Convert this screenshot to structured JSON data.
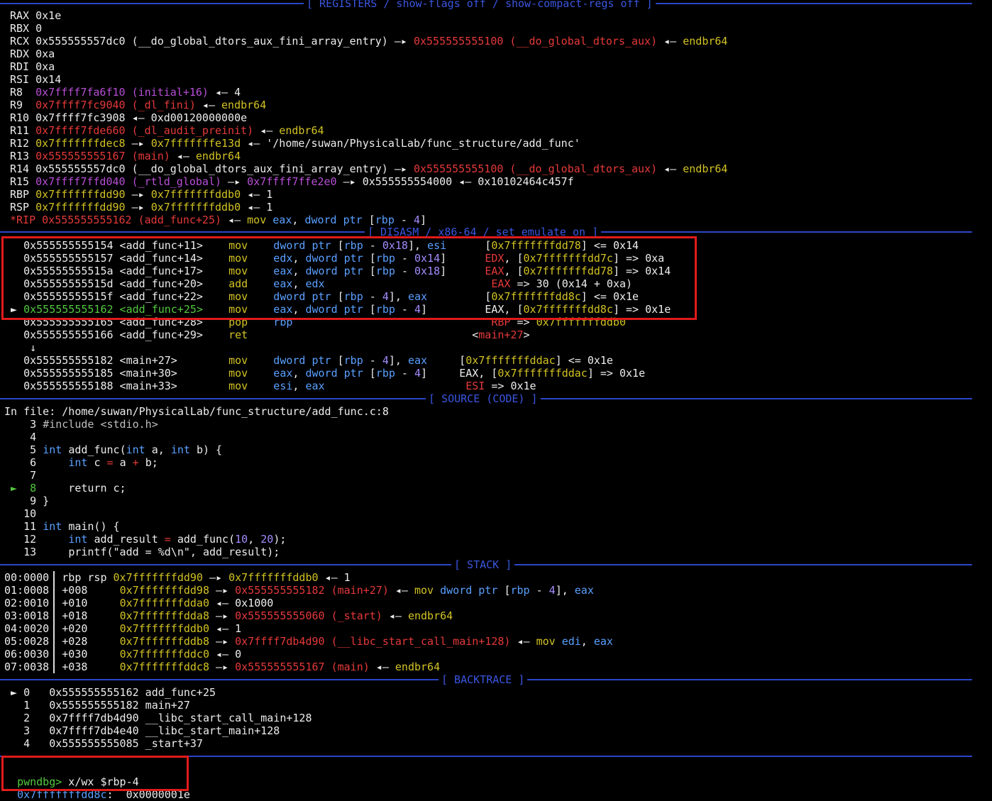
{
  "sections": {
    "registers": "[ REGISTERS / show-flags off / show-compact-regs off ]",
    "disasm": "[ DISASM / x86-64 / set emulate on ]",
    "source": "[ SOURCE (CODE) ]",
    "stack": "[ STACK ]",
    "backtrace": "[ BACKTRACE ]"
  },
  "registers": [
    [
      [
        "RAX ",
        "wht"
      ],
      [
        "0x1e",
        "wht"
      ]
    ],
    [
      [
        "RBX ",
        "wht"
      ],
      [
        "0",
        "wht"
      ]
    ],
    [
      [
        "RCX ",
        "wht"
      ],
      [
        "0x555555557dc0 (__do_global_dtors_aux_fini_array_entry) —▸ ",
        "wht"
      ],
      [
        "0x555555555100 (__do_global_dtors_aux)",
        "red"
      ],
      [
        " ◂— ",
        "wht"
      ],
      [
        "endbr64",
        "yel"
      ]
    ],
    [
      [
        "RDX ",
        "wht"
      ],
      [
        "0xa",
        "wht"
      ]
    ],
    [
      [
        "RDI ",
        "wht"
      ],
      [
        "0xa",
        "wht"
      ]
    ],
    [
      [
        "RSI ",
        "wht"
      ],
      [
        "0x14",
        "wht"
      ]
    ],
    [
      [
        "R8  ",
        "wht"
      ],
      [
        "0x7ffff7fa6f10 (initial+16)",
        "mag"
      ],
      [
        " ◂— 4",
        "wht"
      ]
    ],
    [
      [
        "R9  ",
        "wht"
      ],
      [
        "0x7ffff7fc9040 (_dl_fini)",
        "red"
      ],
      [
        " ◂— ",
        "wht"
      ],
      [
        "endbr64",
        "yel"
      ]
    ],
    [
      [
        "R10 ",
        "wht"
      ],
      [
        "0x7ffff7fc3908 ◂— 0xd00120000000e",
        "wht"
      ]
    ],
    [
      [
        "R11 ",
        "wht"
      ],
      [
        "0x7ffff7fde660 (_dl_audit_preinit)",
        "red"
      ],
      [
        " ◂— ",
        "wht"
      ],
      [
        "endbr64",
        "yel"
      ]
    ],
    [
      [
        "R12 ",
        "wht"
      ],
      [
        "0x7fffffffdec8",
        "yel"
      ],
      [
        " —▸ ",
        "wht"
      ],
      [
        "0x7fffffffe13d",
        "yel"
      ],
      [
        " ◂— '/home/suwan/PhysicalLab/func_structure/add_func'",
        "wht"
      ]
    ],
    [
      [
        "R13 ",
        "wht"
      ],
      [
        "0x555555555167 (main)",
        "red"
      ],
      [
        " ◂— ",
        "wht"
      ],
      [
        "endbr64",
        "yel"
      ]
    ],
    [
      [
        "R14 ",
        "wht"
      ],
      [
        "0x555555557dc0 (__do_global_dtors_aux_fini_array_entry) —▸ ",
        "wht"
      ],
      [
        "0x555555555100 (__do_global_dtors_aux)",
        "red"
      ],
      [
        " ◂— ",
        "wht"
      ],
      [
        "endbr64",
        "yel"
      ]
    ],
    [
      [
        "R15 ",
        "wht"
      ],
      [
        "0x7ffff7ffd040 (_rtld_global)",
        "mag"
      ],
      [
        " —▸ ",
        "wht"
      ],
      [
        "0x7ffff7ffe2e0",
        "mag"
      ],
      [
        " —▸ 0x555555554000 ◂— 0x10102464c457f",
        "wht"
      ]
    ],
    [
      [
        "RBP ",
        "wht"
      ],
      [
        "0x7fffffffdd90",
        "yel"
      ],
      [
        " —▸ ",
        "wht"
      ],
      [
        "0x7fffffffddb0",
        "yel"
      ],
      [
        " ◂— 1",
        "wht"
      ]
    ],
    [
      [
        "RSP ",
        "wht"
      ],
      [
        "0x7fffffffdd90",
        "yel"
      ],
      [
        " —▸ ",
        "wht"
      ],
      [
        "0x7fffffffddb0",
        "yel"
      ],
      [
        " ◂— 1",
        "wht"
      ]
    ],
    [
      [
        "*RIP ",
        "red"
      ],
      [
        "0x555555555162 (add_func+25)",
        "red"
      ],
      [
        " ◂— ",
        "wht"
      ],
      [
        "mov ",
        "yel"
      ],
      [
        "eax",
        "blu"
      ],
      [
        ", ",
        "wht"
      ],
      [
        "dword ptr ",
        "blu"
      ],
      [
        "[",
        "wht"
      ],
      [
        "rbp",
        "blu"
      ],
      [
        " - ",
        "wht"
      ],
      [
        "4",
        "num"
      ],
      [
        "]",
        "wht"
      ]
    ]
  ],
  "disasm": [
    [
      [
        "   0x555555555154 <add_func+11>    ",
        "wht"
      ],
      [
        "mov    ",
        "yel"
      ],
      [
        "dword ptr ",
        "blu"
      ],
      [
        "[",
        "wht"
      ],
      [
        "rbp",
        "blu"
      ],
      [
        " - ",
        "wht"
      ],
      [
        "0x18",
        "num"
      ],
      [
        "], ",
        "wht"
      ],
      [
        "esi",
        "blu"
      ],
      [
        "      [",
        "wht"
      ],
      [
        "0x7fffffffdd78",
        "yel"
      ],
      [
        "] <= 0x14",
        "wht"
      ]
    ],
    [
      [
        "   0x555555555157 <add_func+14>    ",
        "wht"
      ],
      [
        "mov    ",
        "yel"
      ],
      [
        "edx",
        "blu"
      ],
      [
        ", ",
        "wht"
      ],
      [
        "dword ptr ",
        "blu"
      ],
      [
        "[",
        "wht"
      ],
      [
        "rbp",
        "blu"
      ],
      [
        " - ",
        "wht"
      ],
      [
        "0x14",
        "num"
      ],
      [
        "]",
        "wht"
      ],
      [
        "      EDX",
        "red"
      ],
      [
        ", [",
        "wht"
      ],
      [
        "0x7fffffffdd7c",
        "yel"
      ],
      [
        "] => 0xa",
        "wht"
      ]
    ],
    [
      [
        "   0x55555555515a <add_func+17>    ",
        "wht"
      ],
      [
        "mov    ",
        "yel"
      ],
      [
        "eax",
        "blu"
      ],
      [
        ", ",
        "wht"
      ],
      [
        "dword ptr ",
        "blu"
      ],
      [
        "[",
        "wht"
      ],
      [
        "rbp",
        "blu"
      ],
      [
        " - ",
        "wht"
      ],
      [
        "0x18",
        "num"
      ],
      [
        "]",
        "wht"
      ],
      [
        "      EAX",
        "red"
      ],
      [
        ", [",
        "wht"
      ],
      [
        "0x7fffffffdd78",
        "yel"
      ],
      [
        "] => 0x14",
        "wht"
      ]
    ],
    [
      [
        "   0x55555555515d <add_func+20>    ",
        "wht"
      ],
      [
        "add    ",
        "yel"
      ],
      [
        "eax",
        "blu"
      ],
      [
        ", ",
        "wht"
      ],
      [
        "edx",
        "blu"
      ],
      [
        "                          EAX",
        "red"
      ],
      [
        " => 30 (0x14 + 0xa)",
        "wht"
      ]
    ],
    [
      [
        "   0x55555555515f <add_func+22>    ",
        "wht"
      ],
      [
        "mov    ",
        "yel"
      ],
      [
        "dword ptr ",
        "blu"
      ],
      [
        "[",
        "wht"
      ],
      [
        "rbp",
        "blu"
      ],
      [
        " - ",
        "wht"
      ],
      [
        "4",
        "num"
      ],
      [
        "], ",
        "wht"
      ],
      [
        "eax",
        "blu"
      ],
      [
        "         [",
        "wht"
      ],
      [
        "0x7fffffffdd8c",
        "yel"
      ],
      [
        "] <= 0x1e",
        "wht"
      ]
    ],
    [
      [
        " ► ",
        "wht"
      ],
      [
        "0x555555555162 <add_func+25>    ",
        "grn"
      ],
      [
        "mov    ",
        "yel"
      ],
      [
        "eax",
        "blu"
      ],
      [
        ", ",
        "wht"
      ],
      [
        "dword ptr ",
        "blu"
      ],
      [
        "[",
        "wht"
      ],
      [
        "rbp",
        "blu"
      ],
      [
        " - ",
        "wht"
      ],
      [
        "4",
        "num"
      ],
      [
        "]",
        "wht"
      ],
      [
        "         EAX",
        "wht"
      ],
      [
        ", [",
        "wht"
      ],
      [
        "0x7fffffffdd8c",
        "yel"
      ],
      [
        "] => 0x1e",
        "wht"
      ]
    ],
    [
      [
        "   0x555555555165 <add_func+28>    ",
        "wht"
      ],
      [
        "pop    ",
        "yel"
      ],
      [
        "rbp",
        "blu"
      ],
      [
        "                               RBP",
        "red"
      ],
      [
        " => ",
        "wht"
      ],
      [
        "0x7fffffffddb0",
        "yel"
      ]
    ],
    [
      [
        "   0x555555555166 <add_func+29>    ",
        "wht"
      ],
      [
        "ret",
        "yel"
      ],
      [
        "                                   <",
        "wht"
      ],
      [
        "main+27",
        "red"
      ],
      [
        ">",
        "wht"
      ]
    ],
    [
      [
        "    ↓",
        "wht"
      ]
    ],
    [
      [
        "   0x555555555182 <main+27>        ",
        "wht"
      ],
      [
        "mov    ",
        "yel"
      ],
      [
        "dword ptr ",
        "blu"
      ],
      [
        "[",
        "wht"
      ],
      [
        "rbp",
        "blu"
      ],
      [
        " - ",
        "wht"
      ],
      [
        "4",
        "num"
      ],
      [
        "], ",
        "wht"
      ],
      [
        "eax",
        "blu"
      ],
      [
        "     [",
        "wht"
      ],
      [
        "0x7fffffffddac",
        "yel"
      ],
      [
        "] <= 0x1e",
        "wht"
      ]
    ],
    [
      [
        "   0x555555555185 <main+30>        ",
        "wht"
      ],
      [
        "mov    ",
        "yel"
      ],
      [
        "eax",
        "blu"
      ],
      [
        ", ",
        "wht"
      ],
      [
        "dword ptr ",
        "blu"
      ],
      [
        "[",
        "wht"
      ],
      [
        "rbp",
        "blu"
      ],
      [
        " - ",
        "wht"
      ],
      [
        "4",
        "num"
      ],
      [
        "]",
        "wht"
      ],
      [
        "     EAX, [",
        "wht"
      ],
      [
        "0x7fffffffddac",
        "yel"
      ],
      [
        "] => 0x1e",
        "wht"
      ]
    ],
    [
      [
        "   0x555555555188 <main+33>        ",
        "wht"
      ],
      [
        "mov    ",
        "yel"
      ],
      [
        "esi",
        "blu"
      ],
      [
        ", ",
        "wht"
      ],
      [
        "eax",
        "blu"
      ],
      [
        "                      ESI",
        "red"
      ],
      [
        " => 0x1e",
        "wht"
      ]
    ]
  ],
  "source": {
    "file_line": "In file: /home/suwan/PhysicalLab/func_structure/add_func.c:8",
    "lines": [
      [
        [
          "    3 ",
          "wht"
        ],
        [
          "#include <stdio.h>",
          "gry"
        ]
      ],
      [
        [
          "    4",
          "wht"
        ]
      ],
      [
        [
          "    5 ",
          "wht"
        ],
        [
          "int ",
          "blu"
        ],
        [
          "add_func",
          "wht"
        ],
        [
          "(",
          "wht"
        ],
        [
          "int ",
          "blu"
        ],
        [
          "a, ",
          "wht"
        ],
        [
          "int ",
          "blu"
        ],
        [
          "b) {",
          "wht"
        ]
      ],
      [
        [
          "    6     ",
          "wht"
        ],
        [
          "int ",
          "blu"
        ],
        [
          "c ",
          "wht"
        ],
        [
          "= ",
          "red"
        ],
        [
          "a ",
          "wht"
        ],
        [
          "+ ",
          "red"
        ],
        [
          "b;",
          "wht"
        ]
      ],
      [
        [
          "    7",
          "wht"
        ]
      ],
      [
        [
          " ►  ",
          "grn"
        ],
        [
          "8",
          "grn"
        ],
        [
          "     return ",
          "wht"
        ],
        [
          "c;",
          "wht"
        ]
      ],
      [
        [
          "    9 }",
          "wht"
        ]
      ],
      [
        [
          "   10",
          "wht"
        ]
      ],
      [
        [
          "   11 ",
          "wht"
        ],
        [
          "int ",
          "blu"
        ],
        [
          "main() {",
          "wht"
        ]
      ],
      [
        [
          "   12     ",
          "wht"
        ],
        [
          "int ",
          "blu"
        ],
        [
          "add_result ",
          "wht"
        ],
        [
          "= ",
          "red"
        ],
        [
          "add_func(",
          "wht"
        ],
        [
          "10",
          "num"
        ],
        [
          ", ",
          "wht"
        ],
        [
          "20",
          "num"
        ],
        [
          ");",
          "wht"
        ]
      ],
      [
        [
          "   13     ",
          "wht"
        ],
        [
          "printf(\"add = ",
          "wht"
        ],
        [
          "%d\\n",
          "wht"
        ],
        [
          "\", add_result);",
          "wht"
        ]
      ]
    ]
  },
  "stack": [
    [
      [
        "00:0000",
        "wht"
      ],
      [
        "  rbp rsp ",
        "wht"
      ],
      [
        "0x7fffffffdd90",
        "yel"
      ],
      [
        " —▸ ",
        "wht"
      ],
      [
        "0x7fffffffddb0",
        "yel"
      ],
      [
        " ◂— 1",
        "wht"
      ]
    ],
    [
      [
        "01:0008",
        "wht"
      ],
      [
        "  +008     ",
        "wht"
      ],
      [
        "0x7fffffffdd98",
        "yel"
      ],
      [
        " —▸ ",
        "wht"
      ],
      [
        "0x555555555182 (main+27)",
        "red"
      ],
      [
        " ◂— ",
        "wht"
      ],
      [
        "mov ",
        "yel"
      ],
      [
        "dword ptr ",
        "blu"
      ],
      [
        "[",
        "wht"
      ],
      [
        "rbp",
        "blu"
      ],
      [
        " - ",
        "wht"
      ],
      [
        "4",
        "num"
      ],
      [
        "], ",
        "wht"
      ],
      [
        "eax",
        "blu"
      ]
    ],
    [
      [
        "02:0010",
        "wht"
      ],
      [
        "  +010     ",
        "wht"
      ],
      [
        "0x7fffffffdda0",
        "yel"
      ],
      [
        " ◂— 0x1000",
        "wht"
      ]
    ],
    [
      [
        "03:0018",
        "wht"
      ],
      [
        "  +018     ",
        "wht"
      ],
      [
        "0x7fffffffdda8",
        "yel"
      ],
      [
        " —▸ ",
        "wht"
      ],
      [
        "0x555555555060 (_start)",
        "red"
      ],
      [
        " ◂— ",
        "wht"
      ],
      [
        "endbr64",
        "yel"
      ]
    ],
    [
      [
        "04:0020",
        "wht"
      ],
      [
        "  +020     ",
        "wht"
      ],
      [
        "0x7fffffffddb0",
        "yel"
      ],
      [
        " ◂— 1",
        "wht"
      ]
    ],
    [
      [
        "05:0028",
        "wht"
      ],
      [
        "  +028     ",
        "wht"
      ],
      [
        "0x7fffffffddb8",
        "yel"
      ],
      [
        " —▸ ",
        "wht"
      ],
      [
        "0x7ffff7db4d90 (__libc_start_call_main+128)",
        "red"
      ],
      [
        " ◂— ",
        "wht"
      ],
      [
        "mov ",
        "yel"
      ],
      [
        "edi",
        "blu"
      ],
      [
        ", ",
        "wht"
      ],
      [
        "eax",
        "blu"
      ]
    ],
    [
      [
        "06:0030",
        "wht"
      ],
      [
        "  +030     ",
        "wht"
      ],
      [
        "0x7fffffffddc0",
        "yel"
      ],
      [
        " ◂— 0",
        "wht"
      ]
    ],
    [
      [
        "07:0038",
        "wht"
      ],
      [
        "  +038     ",
        "wht"
      ],
      [
        "0x7fffffffddc8",
        "yel"
      ],
      [
        " —▸ ",
        "wht"
      ],
      [
        "0x555555555167 (main)",
        "red"
      ],
      [
        " ◂— ",
        "wht"
      ],
      [
        "endbr64",
        "yel"
      ]
    ]
  ],
  "backtrace": [
    [
      [
        " ► 0   0x555555555162 add_func+25",
        "wht"
      ]
    ],
    [
      [
        "   1   0x555555555182 main+27",
        "wht"
      ]
    ],
    [
      [
        "   2   0x7ffff7db4d90 __libc_start_call_main+128",
        "wht"
      ]
    ],
    [
      [
        "   3   0x7ffff7db4e40 __libc_start_main+128",
        "wht"
      ]
    ],
    [
      [
        "   4   0x555555555085 _start+37",
        "wht"
      ]
    ]
  ],
  "prompt": {
    "label": "pwndbg>",
    "command": " x/wx $rbp-4",
    "result_addr": "0x7fffffffdd8c",
    "result_value": ":  0x0000001e"
  },
  "colors": {
    "red": "#e5393a",
    "magenta": "#b84fd6",
    "yellow": "#d2c224",
    "green": "#53c93f",
    "blue": "#5aa0ff",
    "purple_number": "#a58cff",
    "separator": "#2a46c8",
    "highlight_box": "#e01b1b"
  }
}
